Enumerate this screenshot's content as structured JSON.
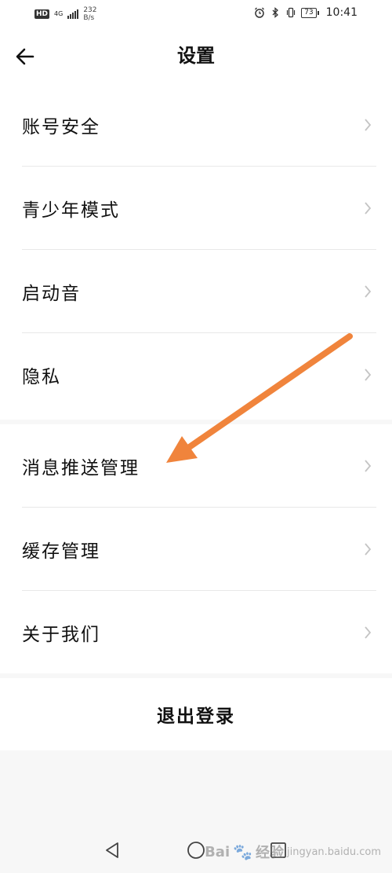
{
  "status_bar": {
    "hd": "HD",
    "network": "4G",
    "speed_value": "232",
    "speed_unit": "B/s",
    "battery": "73",
    "time": "10:41",
    "icons": [
      "alarm-icon",
      "bluetooth-icon",
      "vibrate-icon"
    ]
  },
  "header": {
    "title": "设置",
    "back_icon": "back-arrow-icon"
  },
  "settings": {
    "group1": [
      {
        "label": "账号安全"
      },
      {
        "label": "青少年模式"
      },
      {
        "label": "启动音"
      },
      {
        "label": "隐私"
      }
    ],
    "group2": [
      {
        "label": "消息推送管理"
      },
      {
        "label": "缓存管理"
      },
      {
        "label": "关于我们"
      }
    ]
  },
  "logout": {
    "label": "退出登录"
  },
  "annotation": {
    "color": "#f0843c",
    "points_to": "消息推送管理"
  },
  "nav_bar": {
    "icons": [
      "back-triangle-icon",
      "home-circle-icon",
      "recent-square-icon"
    ]
  },
  "watermark": {
    "text": "Bai",
    "text2": "经验",
    "subtext": "jingyan.baidu.com"
  }
}
